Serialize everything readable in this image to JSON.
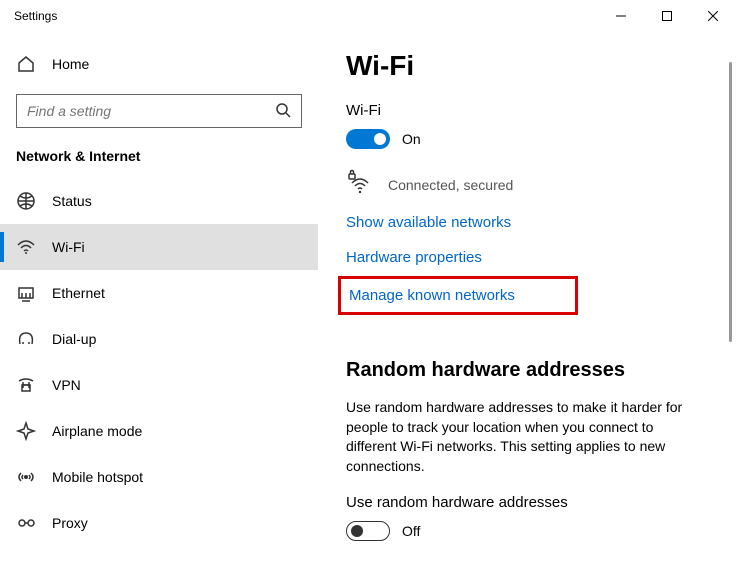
{
  "titlebar": {
    "title": "Settings"
  },
  "sidebar": {
    "home_label": "Home",
    "search_placeholder": "Find a setting",
    "category": "Network & Internet",
    "items": [
      {
        "label": "Status"
      },
      {
        "label": "Wi-Fi"
      },
      {
        "label": "Ethernet"
      },
      {
        "label": "Dial-up"
      },
      {
        "label": "VPN"
      },
      {
        "label": "Airplane mode"
      },
      {
        "label": "Mobile hotspot"
      },
      {
        "label": "Proxy"
      }
    ]
  },
  "content": {
    "page_title": "Wi-Fi",
    "wifi_label": "Wi-Fi",
    "wifi_toggle_state": "On",
    "connection_status": "Connected, secured",
    "link_show_available": "Show available networks",
    "link_hardware": "Hardware properties",
    "link_manage_known": "Manage known networks",
    "random_title": "Random hardware addresses",
    "random_desc": "Use random hardware addresses to make it harder for people to track your location when you connect to different Wi-Fi networks. This setting applies to new connections.",
    "random_toggle_label": "Use random hardware addresses",
    "random_toggle_state": "Off"
  }
}
